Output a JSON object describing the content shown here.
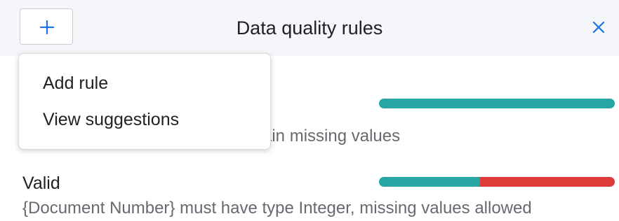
{
  "header": {
    "title": "Data quality rules",
    "add_icon": "plus-icon",
    "close_icon": "close-icon",
    "accent_color": "#1a73e8"
  },
  "add_menu": {
    "items": [
      {
        "label": "Add rule"
      },
      {
        "label": "View suggestions"
      }
    ]
  },
  "rules": [
    {
      "label": "",
      "description": "ain missing values",
      "valid_fraction": 1.0
    },
    {
      "label": "Valid",
      "description": "{Document Number} must have type Integer, missing values allowed",
      "valid_fraction": 0.43
    }
  ],
  "colors": {
    "valid": "#26a6a4",
    "invalid": "#e03b3b"
  }
}
